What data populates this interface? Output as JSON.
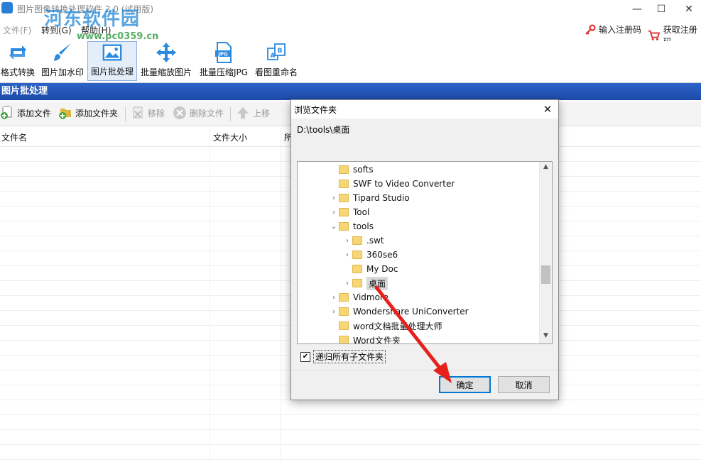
{
  "window": {
    "title": "图片图像转换处理软件 2.0 (试用版)",
    "watermark": "河东软件园",
    "watermark_url": "www.pc0359.cn",
    "controls": {
      "minimize": "—",
      "maximize": "☐",
      "close": "✕"
    }
  },
  "menu": {
    "items": [
      "文件(F)",
      "转到(G)",
      "帮助(H)"
    ],
    "register": "输入注册码",
    "get_register": "获取注册码"
  },
  "toolbar": {
    "items": [
      {
        "label": "格式转换",
        "icon": "rotate-arrows-icon"
      },
      {
        "label": "图片加水印",
        "icon": "brush-icon"
      },
      {
        "label": "图片批处理",
        "icon": "image-icon",
        "active": true
      },
      {
        "label": "批量缩放图片",
        "icon": "move-arrows-icon"
      },
      {
        "label": "批量压缩JPG",
        "icon": "jpg-file-icon"
      },
      {
        "label": "看图重命名",
        "icon": "rename-ab-icon"
      }
    ]
  },
  "section": {
    "title": "图片批处理"
  },
  "subtoolbar": {
    "add_file": "添加文件",
    "add_folder": "添加文件夹",
    "remove": "移除",
    "delete_file": "删除文件",
    "move_up": "上移"
  },
  "table": {
    "columns": [
      "文件名",
      "文件大小",
      "所"
    ]
  },
  "dialog": {
    "title": "浏览文件夹",
    "close": "✕",
    "path": "D:\\tools\\桌面",
    "tree": [
      {
        "label": "softs",
        "level": 0,
        "chevron": ""
      },
      {
        "label": "SWF to Video Converter",
        "level": 0,
        "chevron": ""
      },
      {
        "label": "Tipard Studio",
        "level": 0,
        "chevron": "›"
      },
      {
        "label": "Tool",
        "level": 0,
        "chevron": "›"
      },
      {
        "label": "tools",
        "level": 0,
        "chevron": "⌄"
      },
      {
        "label": ".swt",
        "level": 1,
        "chevron": "›"
      },
      {
        "label": "360se6",
        "level": 1,
        "chevron": "›"
      },
      {
        "label": "My Doc",
        "level": 1,
        "chevron": ""
      },
      {
        "label": "桌面",
        "level": 1,
        "chevron": "›",
        "selected": true
      },
      {
        "label": "Vidmore",
        "level": 0,
        "chevron": "›"
      },
      {
        "label": "Wondershare UniConverter",
        "level": 0,
        "chevron": "›"
      },
      {
        "label": "word文档批量处理大师",
        "level": 0,
        "chevron": ""
      },
      {
        "label": "Word文件夹",
        "level": 0,
        "chevron": ""
      }
    ],
    "recurse_checked": "✔",
    "recurse_label": "递归所有子文件夹",
    "ok": "确定",
    "cancel": "取消"
  },
  "colors": {
    "header_blue": "#2d63c8",
    "arrow_red": "#e8201c",
    "icon_blue": "#2b8ae0"
  }
}
